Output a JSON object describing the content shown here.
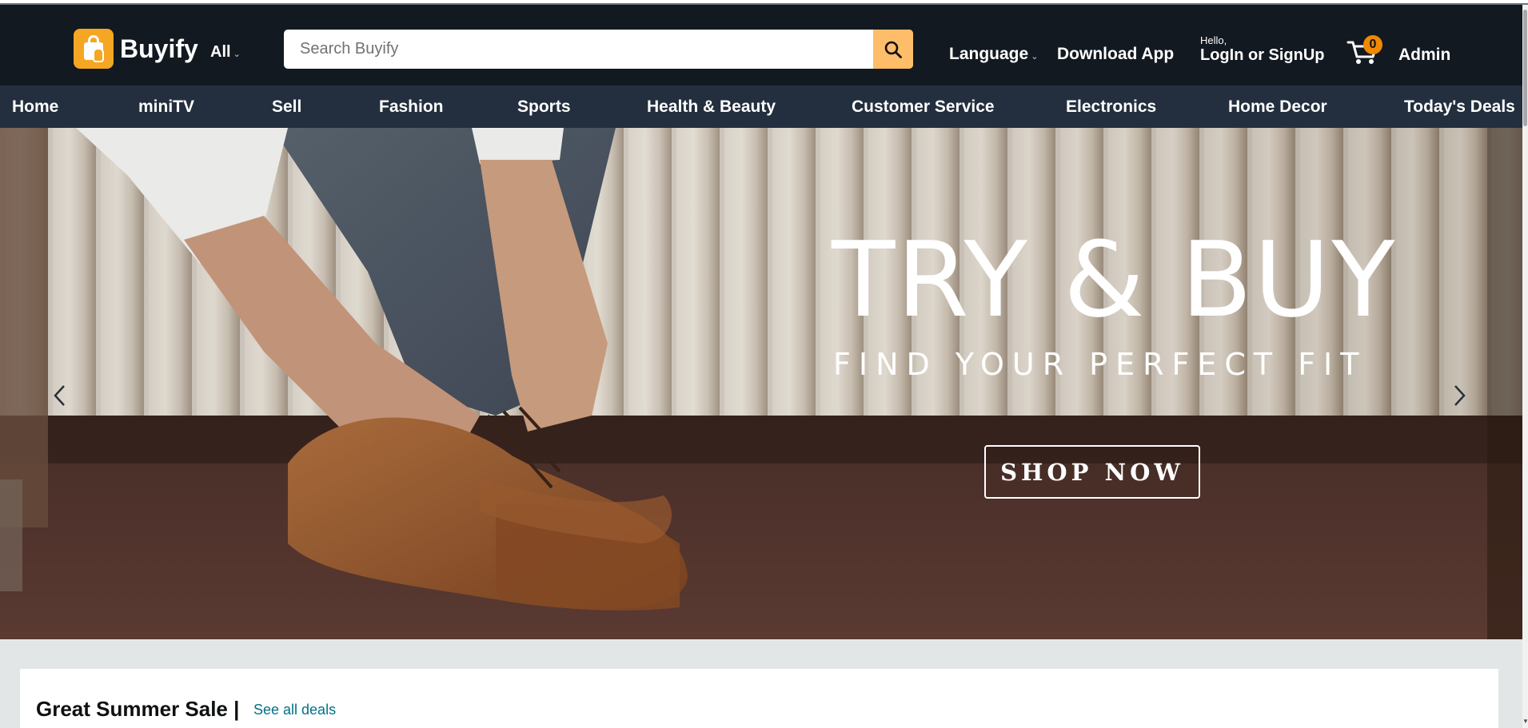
{
  "header": {
    "brand": "Buyify",
    "all_label": "All",
    "search_placeholder": "Search Buyify",
    "language_label": "Language",
    "download_label": "Download App",
    "hello_label": "Hello,",
    "login_label": "LogIn or SignUp",
    "cart_count": "0",
    "admin_label": "Admin"
  },
  "nav": {
    "items": [
      {
        "label": "Home"
      },
      {
        "label": "miniTV"
      },
      {
        "label": "Sell"
      },
      {
        "label": "Fashion"
      },
      {
        "label": "Sports"
      },
      {
        "label": "Health & Beauty"
      },
      {
        "label": "Customer Service"
      },
      {
        "label": "Electronics"
      },
      {
        "label": "Home Decor"
      },
      {
        "label": "Today's Deals"
      }
    ]
  },
  "hero": {
    "headline": "TRY & BUY",
    "subheadline": "FIND YOUR PERFECT FIT",
    "cta_label": "SHOP NOW"
  },
  "deals": {
    "title": "Great Summer Sale |",
    "link_label": "See all deals"
  },
  "colors": {
    "header_bg": "#131921",
    "nav_bg": "#232f3e",
    "search_button": "#febd69",
    "logo_accent": "#f5a623",
    "cart_badge": "#f08804",
    "link": "#007185"
  }
}
